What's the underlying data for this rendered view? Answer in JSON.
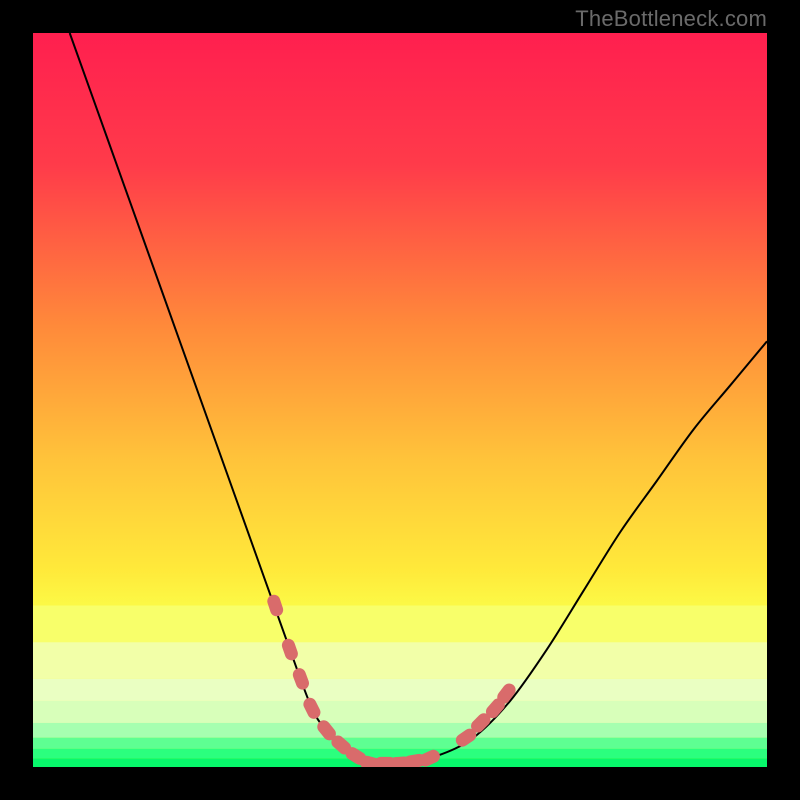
{
  "watermark": "TheBottleneck.com",
  "chart_data": {
    "type": "line",
    "title": "",
    "xlabel": "",
    "ylabel": "",
    "xlim": [
      0,
      100
    ],
    "ylim": [
      0,
      100
    ],
    "grid": false,
    "legend": false,
    "series": [
      {
        "name": "curve-left",
        "x": [
          5,
          10,
          15,
          20,
          25,
          30,
          35,
          38,
          40,
          42,
          44,
          46
        ],
        "y": [
          100,
          86,
          72,
          58,
          44,
          30,
          16,
          8,
          5,
          3,
          1.5,
          0.5
        ]
      },
      {
        "name": "curve-right",
        "x": [
          46,
          50,
          55,
          60,
          65,
          70,
          75,
          80,
          85,
          90,
          95,
          100
        ],
        "y": [
          0.5,
          0.5,
          1.5,
          4,
          9,
          16,
          24,
          32,
          39,
          46,
          52,
          58
        ]
      }
    ],
    "markers": {
      "name": "markers-pink",
      "color": "#d96b6b",
      "points": [
        {
          "x": 33,
          "y": 22
        },
        {
          "x": 35,
          "y": 16
        },
        {
          "x": 36.5,
          "y": 12
        },
        {
          "x": 38,
          "y": 8
        },
        {
          "x": 40,
          "y": 5
        },
        {
          "x": 42,
          "y": 3
        },
        {
          "x": 44,
          "y": 1.5
        },
        {
          "x": 46,
          "y": 0.5
        },
        {
          "x": 48,
          "y": 0.5
        },
        {
          "x": 50,
          "y": 0.5
        },
        {
          "x": 52,
          "y": 0.8
        },
        {
          "x": 54,
          "y": 1.2
        },
        {
          "x": 59,
          "y": 4
        },
        {
          "x": 61,
          "y": 6
        },
        {
          "x": 63,
          "y": 8
        },
        {
          "x": 64.5,
          "y": 10
        }
      ]
    },
    "bands": [
      {
        "name": "band-lime-top",
        "y0": 22,
        "y1": 17,
        "color": "#f8ff6a"
      },
      {
        "name": "band-lime-1",
        "y0": 17,
        "y1": 12,
        "color": "#f2ffa8"
      },
      {
        "name": "band-lime-2",
        "y0": 12,
        "y1": 9,
        "color": "#eaffc2"
      },
      {
        "name": "band-pale",
        "y0": 9,
        "y1": 6,
        "color": "#d8ffba"
      },
      {
        "name": "band-mint",
        "y0": 6,
        "y1": 4,
        "color": "#a6ffb0"
      },
      {
        "name": "band-green-1",
        "y0": 4,
        "y1": 2.5,
        "color": "#5eff92"
      },
      {
        "name": "band-green-2",
        "y0": 2.5,
        "y1": 1.2,
        "color": "#2bff7e"
      },
      {
        "name": "band-green-3",
        "y0": 1.2,
        "y1": 0,
        "color": "#07f86b"
      }
    ],
    "gradient_stops": [
      {
        "offset": 0,
        "color": "#ff1f4f"
      },
      {
        "offset": 18,
        "color": "#ff3b4a"
      },
      {
        "offset": 40,
        "color": "#ff8a3a"
      },
      {
        "offset": 58,
        "color": "#ffc33a"
      },
      {
        "offset": 73,
        "color": "#ffe93a"
      },
      {
        "offset": 80,
        "color": "#fbff4a"
      }
    ]
  }
}
